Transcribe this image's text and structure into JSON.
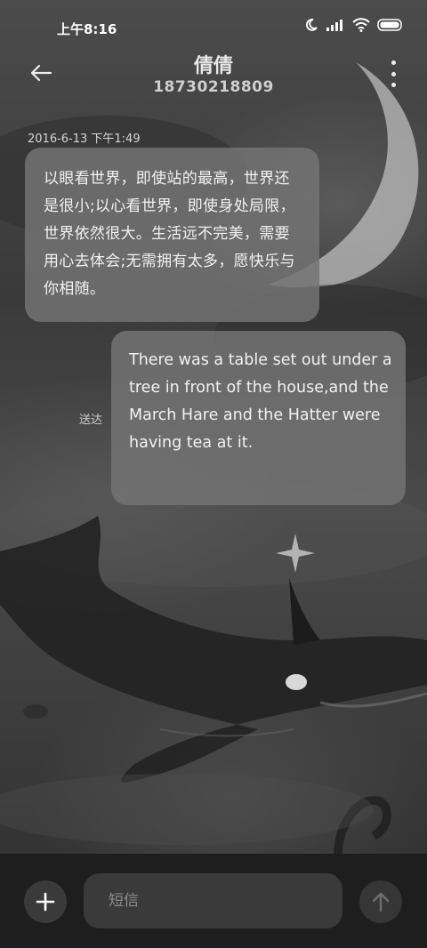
{
  "status_bar": {
    "time": "上午8:16"
  },
  "header": {
    "contact_name": "倩倩",
    "contact_number": "18730218809"
  },
  "messages": [
    {
      "direction": "incoming",
      "timestamp": "2016-6-13 下午1:49",
      "text": "以眼看世界，即使站的最高，世界还是很小;以心看世界，即使身处局限，世界依然很大。生活远不完美，需要用心去体会;无需拥有太多，愿快乐与你相随。"
    },
    {
      "direction": "outgoing",
      "status": "送达",
      "text": "There was a table set out under a tree in front of the house,and the March Hare and the Hatter were having tea at it."
    }
  ],
  "composer": {
    "placeholder": "短信"
  },
  "icons": {
    "back": "arrow-left-icon",
    "more": "more-vertical-icon",
    "add": "plus-icon",
    "send": "arrow-up-icon"
  }
}
